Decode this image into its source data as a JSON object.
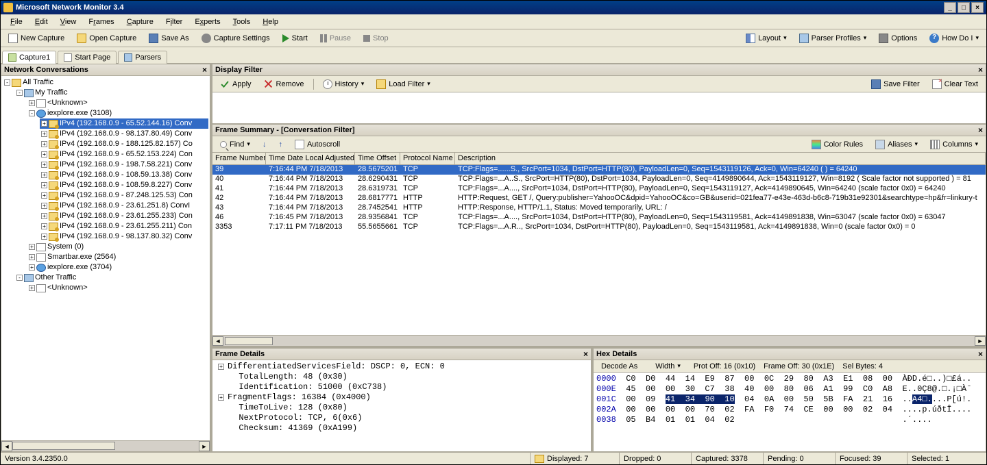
{
  "title": "Microsoft Network Monitor 3.4",
  "menu": [
    "File",
    "Edit",
    "View",
    "Frames",
    "Capture",
    "Filter",
    "Experts",
    "Tools",
    "Help"
  ],
  "toolbar": {
    "new": "New Capture",
    "open": "Open Capture",
    "save": "Save As",
    "settings": "Capture Settings",
    "start": "Start",
    "pause": "Pause",
    "stop": "Stop"
  },
  "rtoolbar": {
    "layout": "Layout",
    "parser": "Parser Profiles",
    "options": "Options",
    "help": "How Do I"
  },
  "tabs": {
    "capture": "Capture1",
    "start": "Start Page",
    "parsers": "Parsers"
  },
  "netconv": {
    "title": "Network Conversations",
    "all": "All Traffic",
    "my": "My Traffic",
    "unknown": "<Unknown>",
    "ie1": "iexplore.exe (3108)",
    "convs": [
      "IPv4 (192.168.0.9 - 65.52.144.16) Conv",
      "IPv4 (192.168.0.9 - 98.137.80.49) Conv",
      "IPv4 (192.168.0.9 - 188.125.82.157) Co",
      "IPv4 (192.168.0.9 - 65.52.153.224) Con",
      "IPv4 (192.168.0.9 - 198.7.58.221) Conv",
      "IPv4 (192.168.0.9 - 108.59.13.38) Conv",
      "IPv4 (192.168.0.9 - 108.59.8.227) Conv",
      "IPv4 (192.168.0.9 - 87.248.125.53) Con",
      "IPv4 (192.168.0.9 - 23.61.251.8) ConvI",
      "IPv4 (192.168.0.9 - 23.61.255.233) Con",
      "IPv4 (192.168.0.9 - 23.61.255.211) Con",
      "IPv4 (192.168.0.9 - 98.137.80.32) Conv"
    ],
    "system": "System (0)",
    "smartbar": "Smartbar.exe (2564)",
    "ie2": "iexplore.exe (3704)",
    "other": "Other Traffic"
  },
  "displayFilter": {
    "title": "Display Filter",
    "apply": "Apply",
    "remove": "Remove",
    "history": "History",
    "load": "Load Filter",
    "save": "Save Filter",
    "clear": "Clear Text"
  },
  "frameSummary": {
    "title": "Frame Summary - [Conversation Filter]",
    "find": "Find",
    "autoscroll": "Autoscroll",
    "colorRules": "Color Rules",
    "aliases": "Aliases",
    "columns": "Columns",
    "cols": [
      "Frame Number",
      "Time Date Local Adjusted",
      "Time Offset",
      "Protocol Name",
      "Description"
    ],
    "rows": [
      {
        "fn": "39",
        "td": "7:16:44 PM 7/18/2013",
        "to": "28.5675201",
        "pn": "TCP",
        "de": "TCP:Flags=......S., SrcPort=1034, DstPort=HTTP(80), PayloadLen=0, Seq=1543119126, Ack=0, Win=64240 (  ) = 64240"
      },
      {
        "fn": "40",
        "td": "7:16:44 PM 7/18/2013",
        "to": "28.6290431",
        "pn": "TCP",
        "de": "TCP:Flags=...A..S., SrcPort=HTTP(80), DstPort=1034, PayloadLen=0, Seq=4149890644, Ack=1543119127, Win=8192 ( Scale factor not supported ) = 81"
      },
      {
        "fn": "41",
        "td": "7:16:44 PM 7/18/2013",
        "to": "28.6319731",
        "pn": "TCP",
        "de": "TCP:Flags=...A...., SrcPort=1034, DstPort=HTTP(80), PayloadLen=0, Seq=1543119127, Ack=4149890645, Win=64240 (scale factor 0x0) = 64240"
      },
      {
        "fn": "42",
        "td": "7:16:44 PM 7/18/2013",
        "to": "28.6817771",
        "pn": "HTTP",
        "de": "HTTP:Request, GET /, Query:publisher=YahooOC&dpid=YahooOC&co=GB&userid=021fea77-e43e-463d-b6c8-719b31e92301&searchtype=hp&fr=linkury-t"
      },
      {
        "fn": "43",
        "td": "7:16:44 PM 7/18/2013",
        "to": "28.7452541",
        "pn": "HTTP",
        "de": "HTTP:Response, HTTP/1.1, Status: Moved temporarily, URL: /"
      },
      {
        "fn": "46",
        "td": "7:16:45 PM 7/18/2013",
        "to": "28.9356841",
        "pn": "TCP",
        "de": "TCP:Flags=...A...., SrcPort=1034, DstPort=HTTP(80), PayloadLen=0, Seq=1543119581, Ack=4149891838, Win=63047 (scale factor 0x0) = 63047"
      },
      {
        "fn": "3353",
        "td": "7:17:11 PM 7/18/2013",
        "to": "55.5655661",
        "pn": "TCP",
        "de": "TCP:Flags=...A.R.., SrcPort=1034, DstPort=HTTP(80), PayloadLen=0, Seq=1543119581, Ack=4149891838, Win=0 (scale factor 0x0) = 0"
      }
    ]
  },
  "frameDetails": {
    "title": "Frame Details",
    "lines": [
      {
        "t": "+",
        "text": "DifferentiatedServicesField: DSCP: 0, ECN: 0"
      },
      {
        "t": " ",
        "text": "  TotalLength: 48 (0x30)"
      },
      {
        "t": " ",
        "text": "  Identification: 51000 (0xC738)"
      },
      {
        "t": "+",
        "text": "FragmentFlags: 16384 (0x4000)"
      },
      {
        "t": " ",
        "text": "  TimeToLive: 128 (0x80)"
      },
      {
        "t": " ",
        "text": "  NextProtocol: TCP, 6(0x6)"
      },
      {
        "t": " ",
        "text": "  Checksum: 41369 (0xA199)"
      }
    ]
  },
  "hexDetails": {
    "title": "Hex Details",
    "decode": "Decode As",
    "width": "Width",
    "protOff": "Prot Off: 16 (0x10)",
    "frameOff": "Frame Off: 30 (0x1E)",
    "selBytes": "Sel Bytes: 4",
    "rows": [
      {
        "off": "0000",
        "hex": "C0  D0  44  14  E9  87  00  0C  29  80  A3  E1  08  00",
        "asc": "ÀÐD.é□..)□£á.."
      },
      {
        "off": "000E",
        "hex": "45  00  00  30  C7  38  40  00  80  06  A1  99  C0  A8",
        "asc": "E..0Ç8@.□.¡□À¨"
      },
      {
        "off": "001C",
        "hex": "00  09  ",
        "sel": "41  34  90  10",
        "hex2": "  04  0A  00  50  5B  FA  21  16",
        "asc": "..",
        "ascsel": "A4□.",
        "asc2": "...P[ú!."
      },
      {
        "off": "002A",
        "hex": "00  00  00  00  70  02  FA  F0  74  CE  00  00  02  04",
        "asc": "....p.úðtÎ...."
      },
      {
        "off": "0038",
        "hex": "05  B4  01  01  04  02                                ",
        "asc": ".´...."
      }
    ]
  },
  "status": {
    "version": "Version 3.4.2350.0",
    "displayed": "Displayed: 7",
    "dropped": "Dropped: 0",
    "captured": "Captured: 3378",
    "pending": "Pending: 0",
    "focused": "Focused: 39",
    "selected": "Selected: 1"
  }
}
